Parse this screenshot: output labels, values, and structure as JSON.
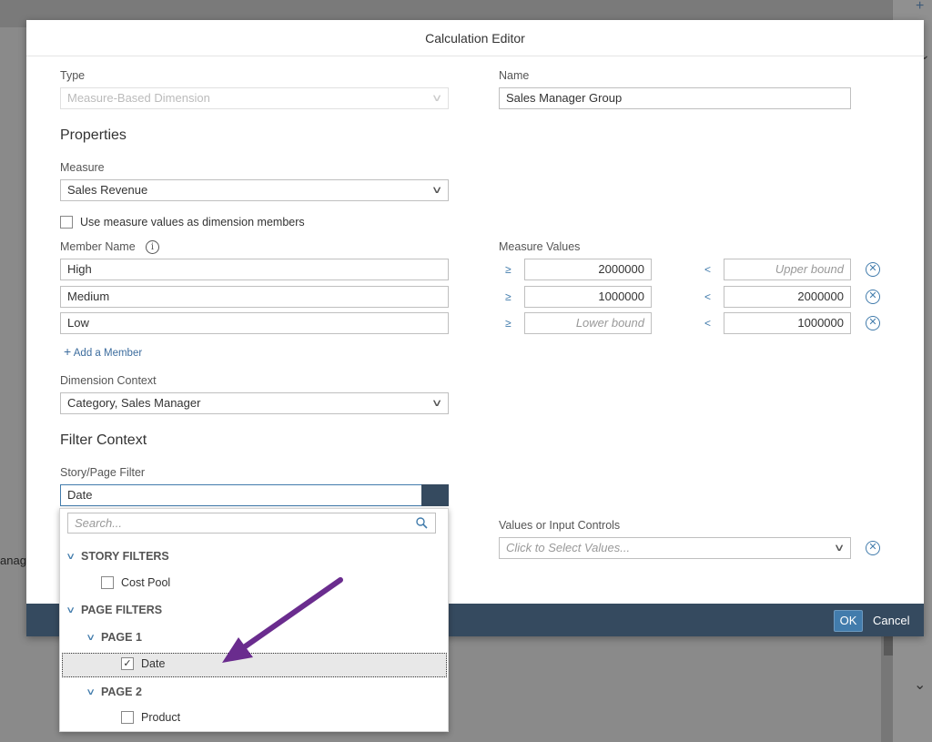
{
  "background": {
    "truncated_text": "anag"
  },
  "dialog": {
    "title": "Calculation Editor",
    "type": {
      "label": "Type",
      "value": "Measure-Based Dimension"
    },
    "name": {
      "label": "Name",
      "value": "Sales Manager Group"
    },
    "properties_heading": "Properties",
    "measure": {
      "label": "Measure",
      "value": "Sales Revenue"
    },
    "use_measure_values_label": "Use measure values as dimension members",
    "member_name_label": "Member Name",
    "measure_values_label": "Measure Values",
    "members": [
      {
        "name": "High",
        "gte": "2000000",
        "lt": "",
        "lt_placeholder": "Upper bound",
        "gte_placeholder": ""
      },
      {
        "name": "Medium",
        "gte": "1000000",
        "lt": "2000000",
        "lt_placeholder": "",
        "gte_placeholder": ""
      },
      {
        "name": "Low",
        "gte": "",
        "lt": "1000000",
        "lt_placeholder": "",
        "gte_placeholder": "Lower bound"
      }
    ],
    "operator_gte": "≥",
    "operator_lt": "<",
    "add_member_label": "Add a Member",
    "dimension_context": {
      "label": "Dimension Context",
      "value": "Category, Sales Manager"
    },
    "filter_context_heading": "Filter Context",
    "story_page_filter": {
      "label": "Story/Page Filter",
      "value": "Date"
    },
    "values_or_input_controls": {
      "label": "Values or Input Controls",
      "placeholder": "Click to Select Values..."
    },
    "ok_label": "OK",
    "cancel_label": "Cancel"
  },
  "dropdown": {
    "search_placeholder": "Search...",
    "story_filters_heading": "STORY FILTERS",
    "story_filters": [
      {
        "label": "Cost Pool",
        "checked": false
      }
    ],
    "page_filters_heading": "PAGE FILTERS",
    "pages": [
      {
        "heading": "PAGE 1",
        "items": [
          {
            "label": "Date",
            "checked": true
          }
        ]
      },
      {
        "heading": "PAGE 2",
        "items": [
          {
            "label": "Product",
            "checked": false
          }
        ]
      }
    ]
  },
  "colors": {
    "accent": "#427cac",
    "footer": "#354a5f",
    "annotation_arrow": "#6a2c8e"
  }
}
